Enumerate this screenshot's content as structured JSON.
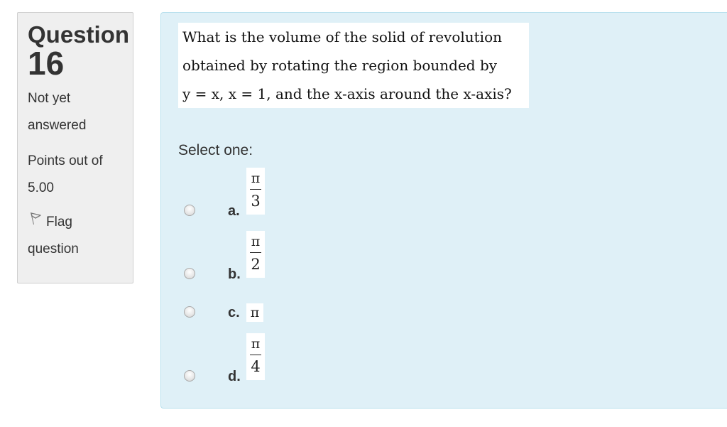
{
  "info": {
    "question_word": "Question",
    "question_number": "16",
    "state": "Not yet answered",
    "grade": "Points out of 5.00",
    "flag_label": "Flag question"
  },
  "question": {
    "lines": [
      "What is the volume of the solid of revolution",
      "obtained by rotating the region bounded by",
      "y = x, x = 1,  and the x-axis around the x-axis?"
    ],
    "prompt": "Select one:",
    "options": [
      {
        "letter": "a.",
        "numerator": "π",
        "denominator": "3"
      },
      {
        "letter": "b.",
        "numerator": "π",
        "denominator": "2"
      },
      {
        "letter": "c.",
        "value": "π"
      },
      {
        "letter": "d.",
        "numerator": "π",
        "denominator": "4"
      }
    ]
  },
  "colors": {
    "content_background": "#dff0f7",
    "content_border": "#b7e0ed",
    "info_background": "#efefef"
  }
}
